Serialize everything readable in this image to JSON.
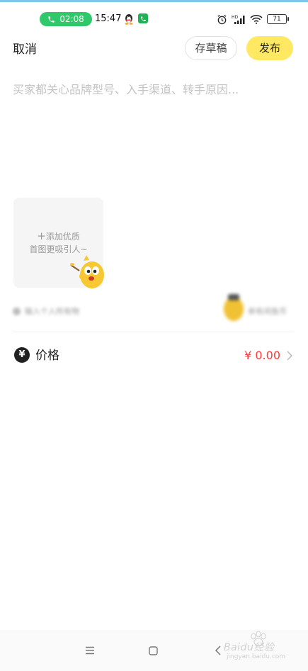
{
  "status_bar": {
    "call_duration": "02:08",
    "time": "15:47",
    "battery": "71",
    "signal_label": "HD"
  },
  "header": {
    "cancel_label": "取消",
    "draft_label": "存草稿",
    "publish_label": "发布"
  },
  "description": {
    "placeholder": "买家都关心品牌型号、入手渠道、转手原因...",
    "value": ""
  },
  "add_photo": {
    "plus": "+",
    "line1": "添加优质",
    "line2": "首图更吸引人~"
  },
  "blurred_row": {
    "left_text": "输入个人所有物",
    "right_text": "单有闲鱼币"
  },
  "price": {
    "icon_glyph": "¥",
    "label": "价格",
    "value": "¥ 0.00"
  },
  "watermark": {
    "text": "Baidu经验",
    "sub": "jingyan.baidu.com"
  },
  "colors": {
    "publish_bg": "#ffe963",
    "price_red": "#ff3b3b",
    "call_green": "#2fc86a"
  }
}
